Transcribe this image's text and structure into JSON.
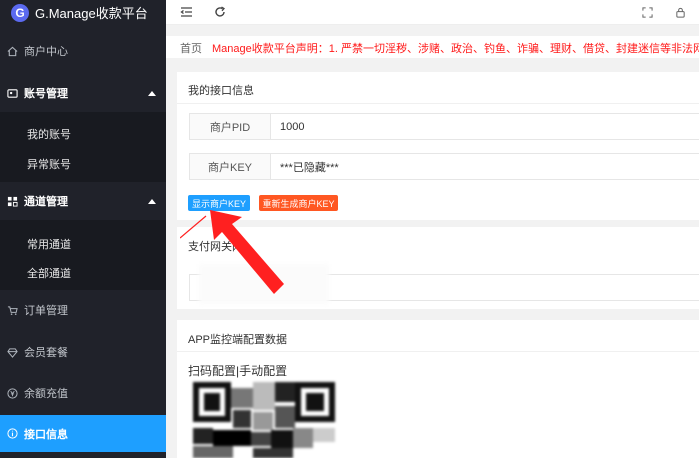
{
  "app": {
    "logo_letter": "G",
    "title": "G.Manage收款平台"
  },
  "sidebar": {
    "items": [
      {
        "label": "商户中心",
        "icon": "home-icon"
      },
      {
        "label": "账号管理",
        "icon": "user-icon"
      },
      {
        "label": "我的账号"
      },
      {
        "label": "异常账号"
      },
      {
        "label": "通道管理",
        "icon": "grid-icon"
      },
      {
        "label": "常用通道"
      },
      {
        "label": "全部通道"
      },
      {
        "label": "订单管理",
        "icon": "cart-icon"
      },
      {
        "label": "会员套餐",
        "icon": "diamond-icon"
      },
      {
        "label": "余额充值",
        "icon": "yen-icon"
      },
      {
        "label": "接口信息",
        "icon": "info-icon"
      }
    ]
  },
  "breadcrumb": {
    "home": "首页",
    "notice": "Manage收款平台声明：1. 严禁一切淫秽、涉赌、政治、钓鱼、诈骗、理财、借贷、封建迷信等非法网站接入"
  },
  "api_card": {
    "title": "我的接口信息",
    "pid_label": "商户PID",
    "pid_value": "1000",
    "key_label": "商户KEY",
    "key_value": "***已隐藏***",
    "show_key_button": "显示商户KEY",
    "regen_key_button": "重新生成商户KEY",
    "gateway_label": "支付网关网"
  },
  "app_card": {
    "title": "APP监控端配置数据",
    "config_text": "扫码配置|手动配置"
  },
  "colors": {
    "sidebar_bg": "#20222a",
    "accent": "#1e9fff",
    "danger": "#ff5722",
    "notice": "#ff1a1a",
    "annotation_arrow": "#ff2020"
  }
}
